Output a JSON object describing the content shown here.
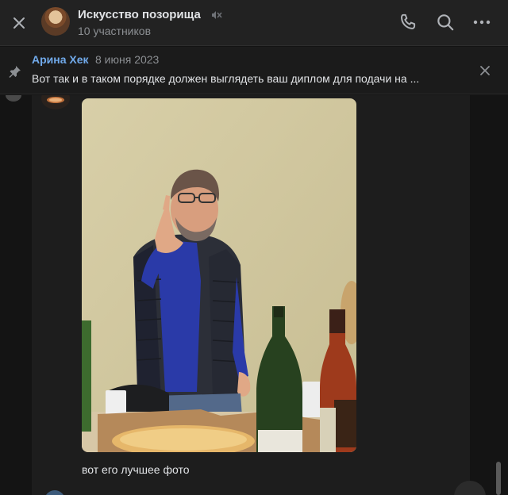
{
  "header": {
    "title": "Искусство позорища",
    "subtitle": "10 участников",
    "close_icon": "close-icon",
    "muted_icon": "muted-speaker-icon",
    "actions": [
      "phone-icon",
      "search-icon",
      "more-icon"
    ]
  },
  "pinned": {
    "author": "Арина Хек",
    "date": "8 июня 2023",
    "text": "Вот так и в таком порядке должен выглядеть ваш диплом для подачи на ..."
  },
  "message": {
    "caption": "вот его лучшее фото"
  },
  "colors": {
    "accent": "#71aaeb",
    "background": "#141414",
    "header": "#222222",
    "text": "#e1e3e6",
    "muted_text": "#8c8f93"
  }
}
